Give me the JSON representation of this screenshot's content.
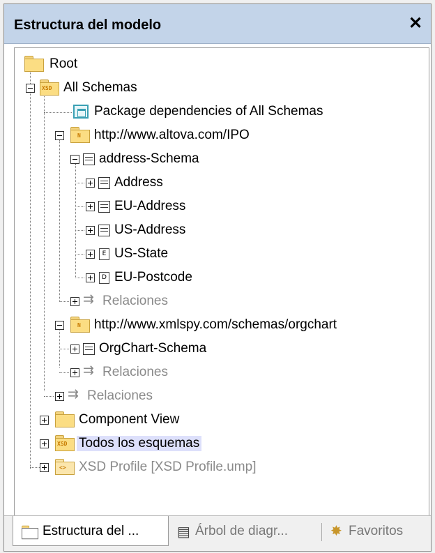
{
  "panel": {
    "title": "Estructura del modelo",
    "close_glyph": "✕"
  },
  "tree": {
    "root": "Root",
    "all_schemas": "All Schemas",
    "package_deps": "Package dependencies of All Schemas",
    "ns_ipo": "http://www.altova.com/IPO",
    "address_schema": "address-Schema",
    "address": "Address",
    "eu_address": "EU-Address",
    "us_address": "US-Address",
    "us_state": "US-State",
    "eu_postcode": "EU-Postcode",
    "relaciones": "Relaciones",
    "ns_orgchart": "http://www.xmlspy.com/schemas/orgchart",
    "orgchart_schema": "OrgChart-Schema",
    "component_view": "Component View",
    "todos_esquemas": "Todos los esquemas",
    "xsd_profile": "XSD Profile [XSD Profile.ump]",
    "icon_xsd_label": "XSD",
    "icon_ns_label": "N",
    "icon_enum_label": "E",
    "icon_datatype_label": "D",
    "icon_profile_label": "<>"
  },
  "tabs": [
    {
      "label": "Estructura del ...",
      "icon": "folder-icon",
      "active": true
    },
    {
      "label": "Árbol de diagr...",
      "icon": "diagram-tree-icon",
      "active": false
    },
    {
      "label": "Favoritos",
      "icon": "star-icon",
      "active": false
    }
  ],
  "colors": {
    "titlebar": "#c3d4e9",
    "highlight": "#dde0fb",
    "folder": "#fbdd83",
    "muted_text": "#8a8a8a"
  }
}
